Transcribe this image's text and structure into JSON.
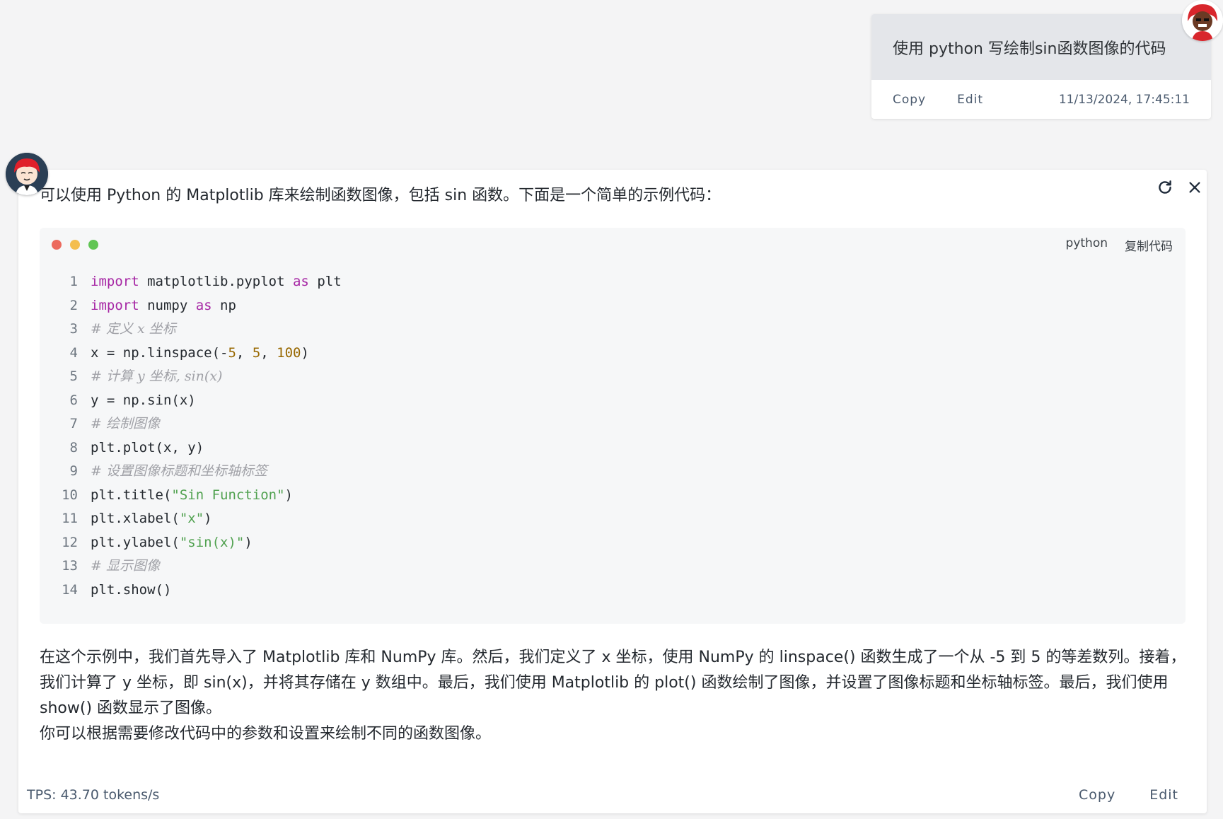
{
  "user_message": {
    "text": "使用 python 写绘制sin函数图像的代码",
    "copy_label": "Copy",
    "edit_label": "Edit",
    "timestamp": "11/13/2024, 17:45:11"
  },
  "assistant_message": {
    "intro": "可以使用 Python 的 Matplotlib 库来绘制函数图像，包括 sin 函数。下面是一个简单的示例代码：",
    "code": {
      "language": "python",
      "copy_label": "复制代码",
      "lines": [
        {
          "n": "1",
          "t": [
            {
              "c": "kw",
              "v": "import"
            },
            {
              "c": "plain",
              "v": " matplotlib.pyplot "
            },
            {
              "c": "kw",
              "v": "as"
            },
            {
              "c": "plain",
              "v": " plt"
            }
          ]
        },
        {
          "n": "2",
          "t": [
            {
              "c": "kw",
              "v": "import"
            },
            {
              "c": "plain",
              "v": " numpy "
            },
            {
              "c": "kw",
              "v": "as"
            },
            {
              "c": "plain",
              "v": " np"
            }
          ]
        },
        {
          "n": "3",
          "t": [
            {
              "c": "cmt",
              "v": "# 定义 x 坐标"
            }
          ]
        },
        {
          "n": "4",
          "t": [
            {
              "c": "plain",
              "v": "x = np.linspace(-"
            },
            {
              "c": "num",
              "v": "5"
            },
            {
              "c": "plain",
              "v": ", "
            },
            {
              "c": "num",
              "v": "5"
            },
            {
              "c": "plain",
              "v": ", "
            },
            {
              "c": "num",
              "v": "100"
            },
            {
              "c": "plain",
              "v": ")"
            }
          ]
        },
        {
          "n": "5",
          "t": [
            {
              "c": "cmt",
              "v": "# 计算 y 坐标, sin(x)"
            }
          ]
        },
        {
          "n": "6",
          "t": [
            {
              "c": "plain",
              "v": "y = np.sin(x)"
            }
          ]
        },
        {
          "n": "7",
          "t": [
            {
              "c": "cmt",
              "v": "# 绘制图像"
            }
          ]
        },
        {
          "n": "8",
          "t": [
            {
              "c": "plain",
              "v": "plt.plot(x, y)"
            }
          ]
        },
        {
          "n": "9",
          "t": [
            {
              "c": "cmt",
              "v": "# 设置图像标题和坐标轴标签"
            }
          ]
        },
        {
          "n": "10",
          "t": [
            {
              "c": "plain",
              "v": "plt.title("
            },
            {
              "c": "str",
              "v": "\"Sin Function\""
            },
            {
              "c": "plain",
              "v": ")"
            }
          ]
        },
        {
          "n": "11",
          "t": [
            {
              "c": "plain",
              "v": "plt.xlabel("
            },
            {
              "c": "str",
              "v": "\"x\""
            },
            {
              "c": "plain",
              "v": ")"
            }
          ]
        },
        {
          "n": "12",
          "t": [
            {
              "c": "plain",
              "v": "plt.ylabel("
            },
            {
              "c": "str",
              "v": "\"sin(x)\""
            },
            {
              "c": "plain",
              "v": ")"
            }
          ]
        },
        {
          "n": "13",
          "t": [
            {
              "c": "cmt",
              "v": "# 显示图像"
            }
          ]
        },
        {
          "n": "14",
          "t": [
            {
              "c": "plain",
              "v": "plt.show()"
            }
          ]
        }
      ]
    },
    "explanation_1": "在这个示例中，我们首先导入了 Matplotlib 库和 NumPy 库。然后，我们定义了 x 坐标，使用 NumPy 的 linspace() 函数生成了一个从 -5 到 5 的等差数列。接着，我们计算了 y 坐标，即 sin(x)，并将其存储在 y 数组中。最后，我们使用 Matplotlib 的 plot() 函数绘制了图像，并设置了图像标题和坐标轴标签。最后，我们使用 show() 函数显示了图像。",
    "explanation_2": "你可以根据需要修改代码中的参数和设置来绘制不同的函数图像。",
    "tps": "TPS: 43.70 tokens/s",
    "copy_label": "Copy",
    "edit_label": "Edit"
  },
  "icons": {
    "regenerate": "refresh-icon",
    "close": "close-icon"
  },
  "colors": {
    "dot_red": "#ec6a5e",
    "dot_yellow": "#f4be4f",
    "dot_green": "#61c554",
    "keyword": "#a626a4",
    "string": "#50a14f",
    "number": "#986801",
    "comment": "#a0a1a7"
  }
}
